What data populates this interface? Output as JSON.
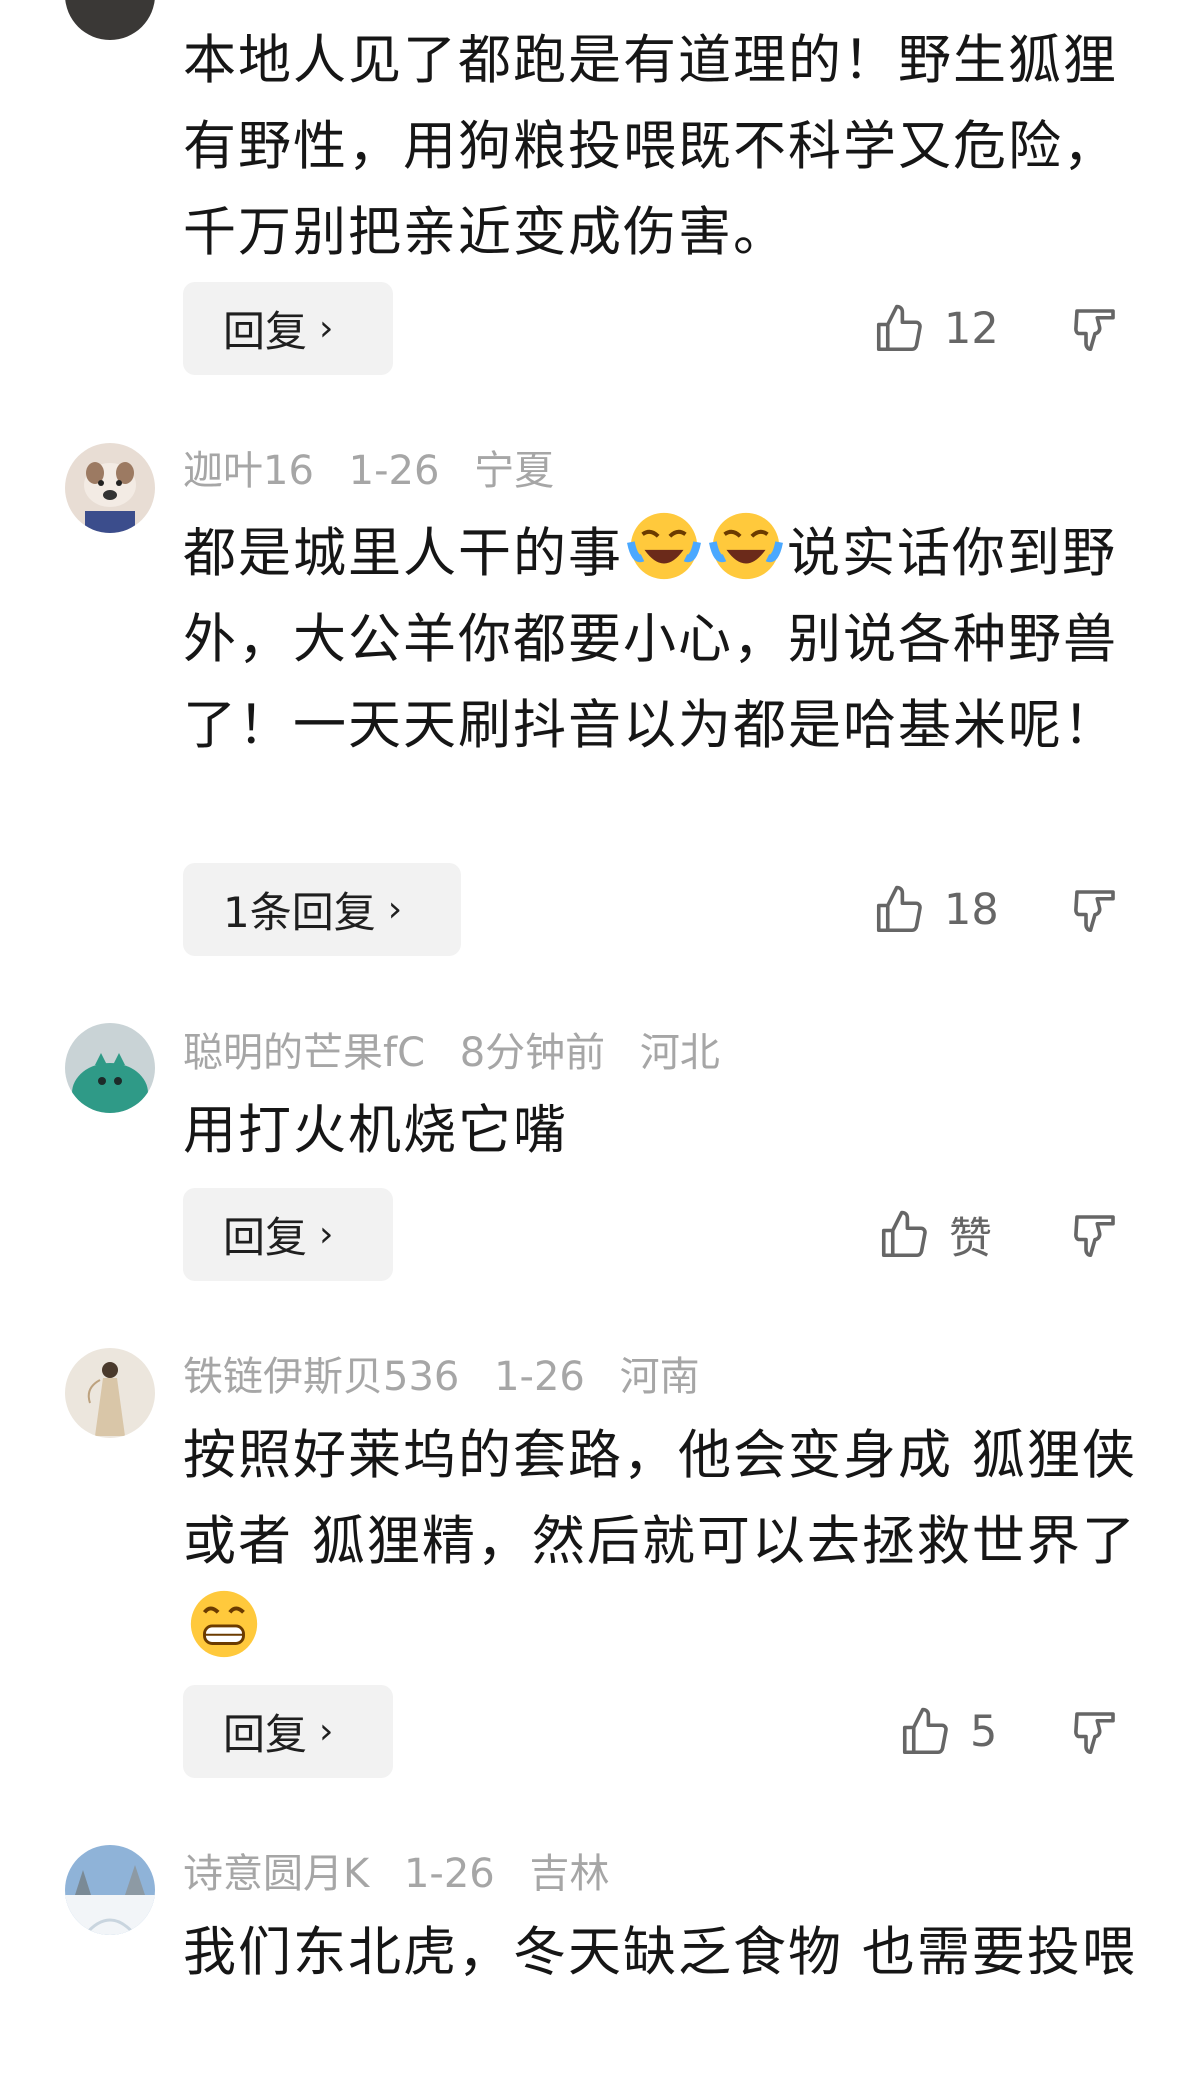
{
  "comments": [
    {
      "avatar": "partial-avatar",
      "text": "本地人见了都跑是有道理的！野生狐狸有野性，用狗粮投喂既不科学又危险，千万别把亲近变成伤害。",
      "reply_label": "回复",
      "likes": "12"
    },
    {
      "avatar": "bulldog-avatar",
      "username": "迦叶16",
      "date": "1-26",
      "location": "宁夏",
      "text_parts": [
        "都是城里人干的事",
        "说实话你到野外，大公羊你都要小心，别说各种野兽了！一天天刷抖音以为都是哈基米呢！"
      ],
      "emoji": "crying-laughing-emoji",
      "reply_label": "1条回复",
      "likes": "18"
    },
    {
      "avatar": "green-creature-avatar",
      "username": "聪明的芒果fC",
      "date": "8分钟前",
      "location": "河北",
      "text": "用打火机烧它嘴",
      "reply_label": "回复",
      "likes": "赞"
    },
    {
      "avatar": "lady-in-dress-avatar",
      "username": "铁链伊斯贝536",
      "date": "1-26",
      "location": "河南",
      "text": "按照好莱坞的套路，他会变身成 狐狸侠 或者 狐狸精，然后就可以去拯救世界了",
      "emoji": "grinning-emoji",
      "reply_label": "回复",
      "likes": "5"
    },
    {
      "avatar": "snow-landscape-avatar",
      "username": "诗意圆月K",
      "date": "1-26",
      "location": "吉林",
      "text": "我们东北虎，冬天缺乏食物 也需要投喂"
    }
  ],
  "colors": {
    "meta": "#a6a6a6",
    "button_bg": "#f2f2f2",
    "emoji_yellow": "#ffc93c"
  }
}
